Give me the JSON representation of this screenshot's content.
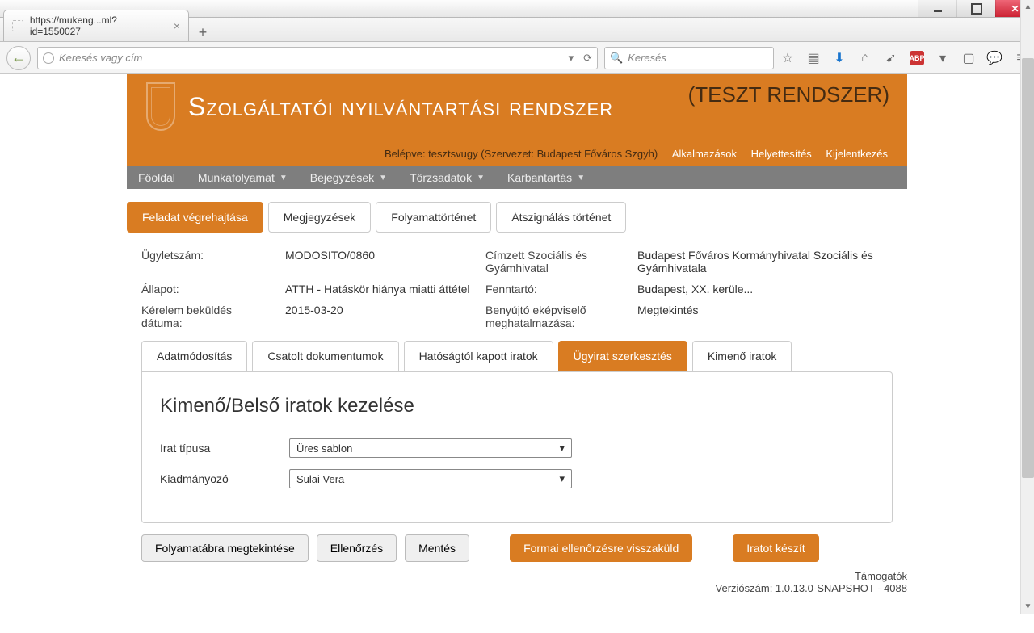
{
  "browser": {
    "tab_title": "https://mukeng...ml?id=1550027",
    "url_placeholder": "Keresés vagy cím",
    "search_placeholder": "Keresés"
  },
  "header": {
    "title": "Szolgáltatói nyilvántartási rendszer",
    "test_label": "(TESZT RENDSZER)",
    "login_prefix": "Belépve: tesztsvugy (Szervezet: Budapest Főváros Szgyh)",
    "links": {
      "apps": "Alkalmazások",
      "subst": "Helyettesítés",
      "logout": "Kijelentkezés"
    }
  },
  "nav": {
    "home": "Főoldal",
    "workflow": "Munkafolyamat",
    "entries": "Bejegyzések",
    "masterdata": "Törzsadatok",
    "maint": "Karbantartás"
  },
  "top_tabs": {
    "exec": "Feladat végrehajtása",
    "notes": "Megjegyzések",
    "history": "Folyamattörténet",
    "reassign": "Átszignálás történet"
  },
  "meta": {
    "caseno_l": "Ügyletszám:",
    "caseno_v": "MODOSITO/0860",
    "recip_l": "Címzett Szociális és Gyámhivatal",
    "recip_v": "Budapest Főváros Kormányhivatal Szociális és Gyámhivatala",
    "status_l": "Állapot:",
    "status_v": "ATTH - Hatáskör hiánya miatti áttétel",
    "maint_l": "Fenntartó:",
    "maint_v": "Budapest, XX. kerüle...",
    "sent_l": "Kérelem beküldés dátuma:",
    "sent_v": "2015-03-20",
    "auth_l": "Benyújtó eképviselő meghatalmazása:",
    "auth_v": "Megtekintés"
  },
  "sub_tabs": {
    "datamod": "Adatmódosítás",
    "attach": "Csatolt dokumentumok",
    "recv": "Hatóságtól kapott iratok",
    "edit": "Ügyirat szerkesztés",
    "out": "Kimenő iratok"
  },
  "panel": {
    "heading": "Kimenő/Belső iratok kezelése",
    "type_l": "Irat típusa",
    "type_v": "Üres sablon",
    "signer_l": "Kiadmányozó",
    "signer_v": "Sulai Vera"
  },
  "buttons": {
    "viewflow": "Folyamatábra megtekintése",
    "check": "Ellenőrzés",
    "save": "Mentés",
    "sendback": "Formai ellenőrzésre visszaküld",
    "makedoc": "Iratot készít"
  },
  "footer": {
    "supporters": "Támogatók",
    "version": "Verziószám: 1.0.13.0-SNAPSHOT - 4088"
  }
}
